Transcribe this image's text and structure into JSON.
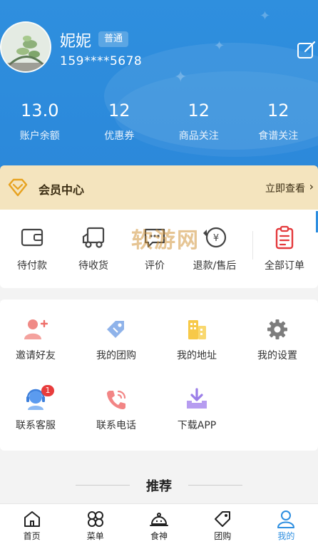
{
  "profile": {
    "name": "妮妮",
    "level": "普通",
    "phone": "159****5678"
  },
  "stats": [
    {
      "value": "13.0",
      "label": "账户余额"
    },
    {
      "value": "12",
      "label": "优惠券"
    },
    {
      "value": "12",
      "label": "商品关注"
    },
    {
      "value": "12",
      "label": "食谱关注"
    }
  ],
  "member": {
    "title": "会员中心",
    "link": "立即查看"
  },
  "orders": [
    {
      "label": "待付款",
      "icon": "wallet-icon"
    },
    {
      "label": "待收货",
      "icon": "truck-icon"
    },
    {
      "label": "评价",
      "icon": "comment-icon"
    },
    {
      "label": "退款/售后",
      "icon": "refund-icon"
    },
    {
      "label": "全部订单",
      "icon": "clipboard-icon"
    }
  ],
  "watermark": "软游网",
  "services": [
    {
      "label": "邀请好友",
      "icon": "add-user-icon"
    },
    {
      "label": "我的团购",
      "icon": "tag-icon"
    },
    {
      "label": "我的地址",
      "icon": "building-icon"
    },
    {
      "label": "我的设置",
      "icon": "gear-icon"
    },
    {
      "label": "联系客服",
      "icon": "support-icon",
      "badge": "1"
    },
    {
      "label": "联系电话",
      "icon": "phone-icon"
    },
    {
      "label": "下载APP",
      "icon": "download-icon"
    }
  ],
  "recommend": {
    "title": "推荐"
  },
  "tabs": [
    {
      "label": "首页",
      "icon": "home-icon"
    },
    {
      "label": "菜单",
      "icon": "menu-grid-icon"
    },
    {
      "label": "食神",
      "icon": "cloche-icon"
    },
    {
      "label": "团购",
      "icon": "tag-icon"
    },
    {
      "label": "我的",
      "icon": "user-icon",
      "active": true
    }
  ],
  "colors": {
    "header_blue": "#2b88da",
    "member_gold": "#f4e4be",
    "active_tab": "#2d8ee0",
    "badge_red": "#e83c3c"
  }
}
